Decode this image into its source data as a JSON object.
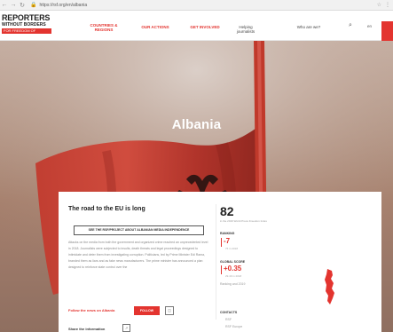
{
  "browser": {
    "url": "https://rsf.org/en/albania"
  },
  "header": {
    "logo_line1": "REPORTERS",
    "logo_line2": "WITHOUT BORDERS",
    "logo_line3": "FOR FREEDOM OF INFORMATION",
    "nav": {
      "countries": "COUNTRIES & REGIONS",
      "actions": "OUR ACTIONS",
      "involved": "GET INVOLVED",
      "helping": "Helping journalists",
      "who": "Who are we?"
    },
    "lang": "en"
  },
  "hero": {
    "title": "Albania"
  },
  "card": {
    "title": "The road to the EU is long",
    "dossier_button": "SEE THE RSF/PROJECT ABOUT ALBANIAN MEDIA INDEPENDENCE",
    "summary": "Attacks on the media from both the government and organized crime reached an unprecedented level in 2018. Journalists were subjected to insults, death threats and legal proceedings designed to intimidate and deter them from investigating corruption. Politicians, led by Prime Minister Edi Rama, branded them as liars and as fake news manufacturers. The prime minister has announced a plan designed to reinforce state control over the",
    "follow_label": "Follow the news on Albania",
    "follow_button": "FOLLOW",
    "rss_icon": "rss-icon",
    "share_label": "Share the information",
    "rank": "82",
    "rank_sub": "in the 2019 World Press Freedom Index",
    "ranking_label": "RANKING",
    "ranking_delta": "-7",
    "ranking_delta_sub": "75 in 2018",
    "score_label": "GLOBAL SCORE",
    "score_delta": "+0.35",
    "score_delta_sub": "29.49 in 2018",
    "methodology": "Ranking and 2019",
    "contacts_label": "CONTACTS",
    "contact_1": "RSF",
    "contact_2": "RSF Europe"
  },
  "colors": {
    "accent": "#e3342f"
  }
}
